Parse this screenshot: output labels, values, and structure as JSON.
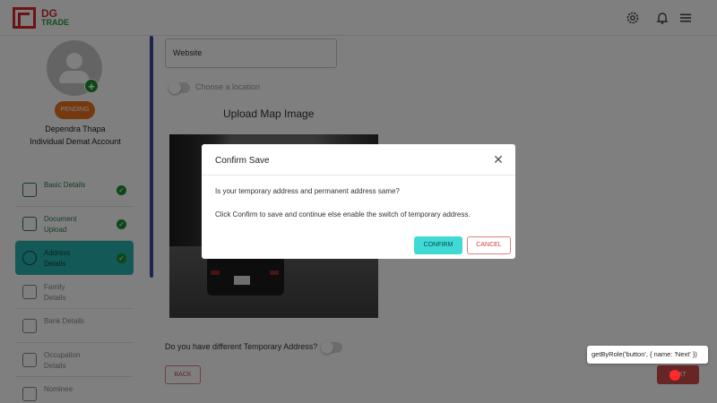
{
  "header": {
    "logo_primary": "DG",
    "logo_secondary": "TRADE",
    "icons": [
      "gear-icon",
      "bell-icon",
      "hamburger-menu-icon"
    ],
    "brand_colors": {
      "red": "#d9262e",
      "green": "#2a9d3a"
    }
  },
  "profile": {
    "status": "PENDING",
    "name": "Dependra Thapa",
    "account_type": "Individual Demat Account"
  },
  "steps": [
    {
      "label": "Basic Details",
      "icon": "user-id-icon",
      "completed": true,
      "active": false
    },
    {
      "label": "Document Upload",
      "icon": "document-icon",
      "completed": true,
      "active": false
    },
    {
      "label": "Address Details",
      "icon": "location-pin-icon",
      "completed": true,
      "active": true
    },
    {
      "label": "Family Details",
      "icon": "family-icon",
      "completed": false,
      "active": false
    },
    {
      "label": "Bank Details",
      "icon": "bank-icon",
      "completed": false,
      "active": false
    },
    {
      "label": "Occupation Details",
      "icon": "briefcase-icon",
      "completed": false,
      "active": false
    },
    {
      "label": "Nominee",
      "icon": "nominee-icon",
      "completed": false,
      "active": false
    }
  ],
  "form": {
    "website_placeholder": "Website",
    "choose_location_label": "Choose a location",
    "upload_map_title": "Upload Map Image",
    "temp_address_question": "Do you have different Temporary Address?",
    "back_label": "BACK",
    "next_label": "NEXT"
  },
  "modal": {
    "title": "Confirm Save",
    "message1": "Is your temporary address and permanent address same?",
    "message2": "Click Confirm to save and continue else enable the switch of temporary address.",
    "confirm_label": "CONFIRM",
    "cancel_label": "CANCEL"
  },
  "tooltip": {
    "text": "getByRole('button', { name: 'Next' })"
  }
}
